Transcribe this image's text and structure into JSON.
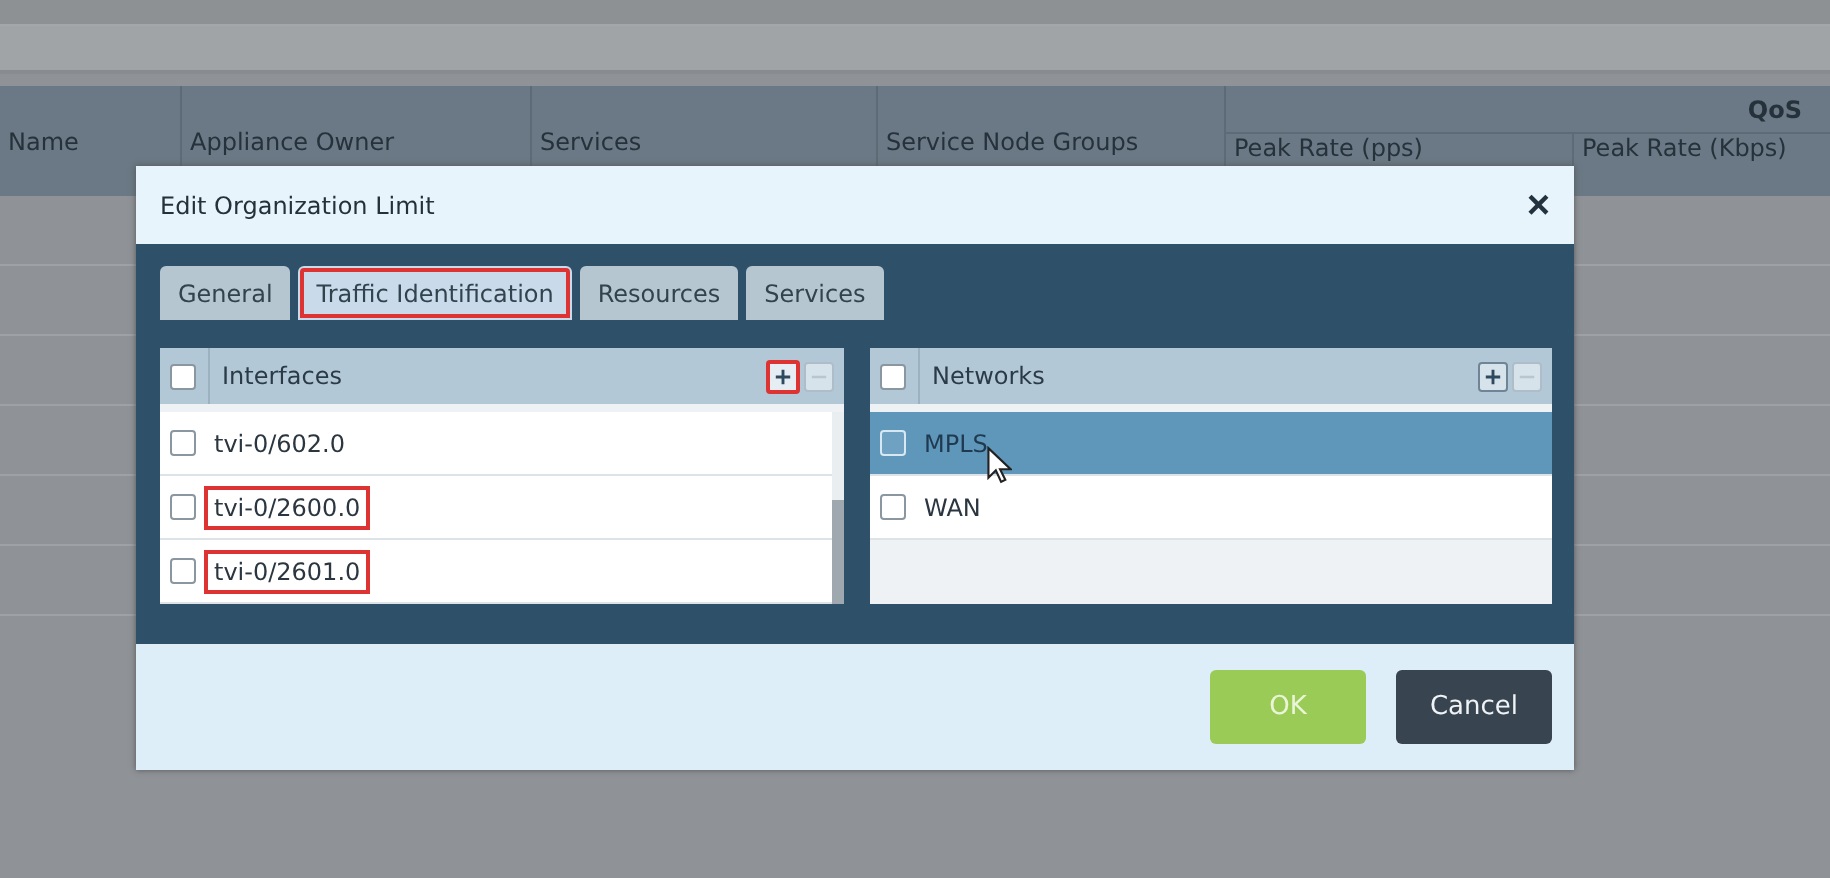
{
  "background_table": {
    "columns": [
      {
        "label": "Name"
      },
      {
        "label": "Appliance Owner"
      },
      {
        "label": "Services"
      },
      {
        "label": "Service Node Groups"
      }
    ],
    "group": {
      "label": "QoS",
      "columns": [
        {
          "label": "Peak Rate (pps)"
        },
        {
          "label": "Peak Rate (Kbps)"
        }
      ]
    }
  },
  "dialog": {
    "title": "Edit Organization Limit",
    "close": "×",
    "tabs": [
      {
        "label": "General",
        "selected": false,
        "annotated": false
      },
      {
        "label": "Traffic Identification",
        "selected": true,
        "annotated": true
      },
      {
        "label": "Resources",
        "selected": false,
        "annotated": false
      },
      {
        "label": "Services",
        "selected": false,
        "annotated": false
      }
    ],
    "panels": [
      {
        "title": "Interfaces",
        "checked": false,
        "add_annotated": true,
        "scrollbar": true,
        "rows": [
          {
            "label": "tvi-0/602.0",
            "checked": false,
            "selected": false,
            "annotated": false
          },
          {
            "label": "tvi-0/2600.0",
            "checked": false,
            "selected": false,
            "annotated": true
          },
          {
            "label": "tvi-0/2601.0",
            "checked": false,
            "selected": false,
            "annotated": true
          }
        ]
      },
      {
        "title": "Networks",
        "checked": false,
        "add_annotated": false,
        "scrollbar": false,
        "rows": [
          {
            "label": "MPLS",
            "checked": false,
            "selected": true,
            "annotated": false
          },
          {
            "label": "WAN",
            "checked": false,
            "selected": false,
            "annotated": false
          }
        ]
      }
    ],
    "buttons": [
      {
        "label": "OK",
        "kind": "primary"
      },
      {
        "label": "Cancel",
        "kind": "secondary"
      }
    ]
  }
}
